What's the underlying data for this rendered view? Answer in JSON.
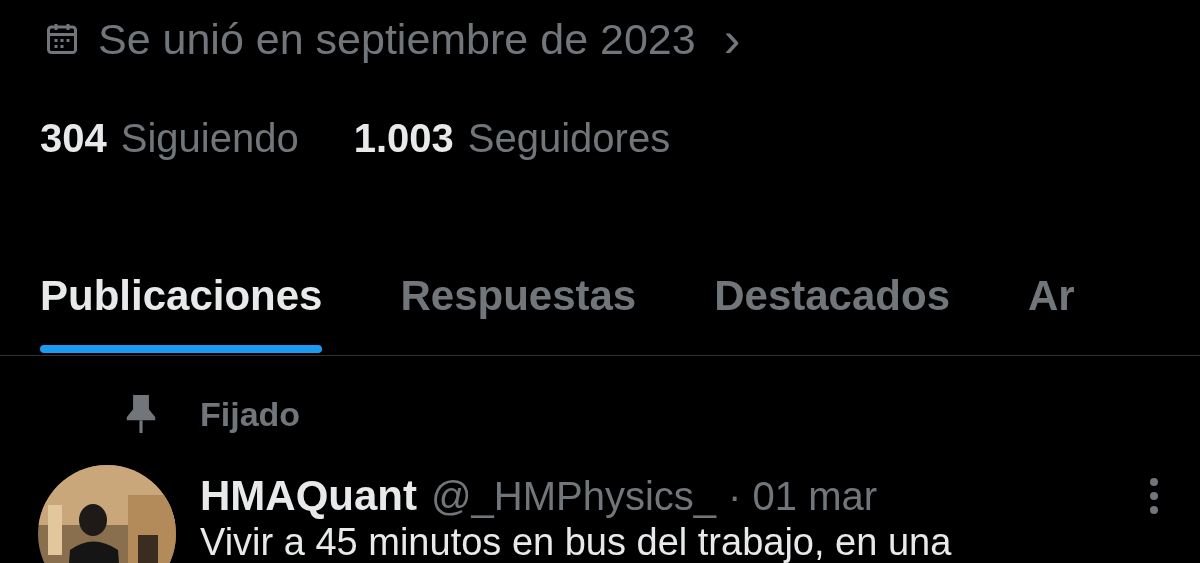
{
  "joined": {
    "text": "Se unió en septiembre de 2023",
    "chevron": "›"
  },
  "stats": [
    {
      "count": "304",
      "label": "Siguiendo"
    },
    {
      "count": "1.003",
      "label": "Seguidores"
    }
  ],
  "tabs": [
    {
      "label": "Publicaciones",
      "selected": true
    },
    {
      "label": "Respuestas",
      "selected": false
    },
    {
      "label": "Destacados",
      "selected": false
    },
    {
      "label": "Ar",
      "selected": false
    }
  ],
  "pinned": {
    "label": "Fijado"
  },
  "post": {
    "name": "HMAQuant",
    "handle": "@_HMPhysics_",
    "time": "· 01 mar",
    "text": "Vivir a 45 minutos en bus del trabajo, en una"
  }
}
